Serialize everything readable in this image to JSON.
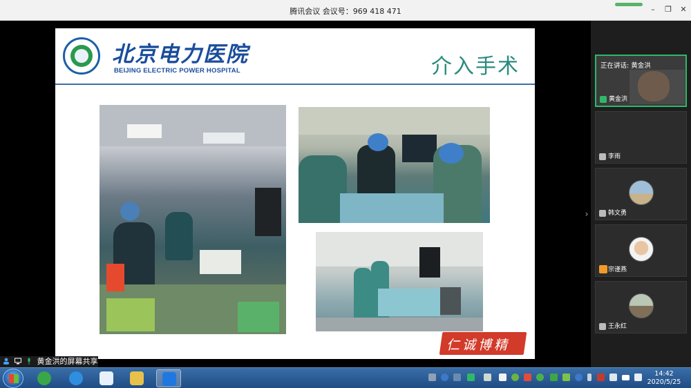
{
  "window": {
    "title": "腾讯会议 会议号：969 418 471",
    "minimize_glyph": "–",
    "restore_glyph": "❐",
    "close_glyph": "✕"
  },
  "slide": {
    "hospital_name_cn": "北京电力医院",
    "hospital_name_en": "BEIJING ELECTRIC POWER HOSPITAL",
    "heading": "介入手术",
    "stamp_text": "仁诚博精"
  },
  "share_label": "黄金洪的屏幕共享",
  "panel": {
    "collapse_glyph": "›",
    "active_speaker_prefix": "正在讲话: 黄金洪",
    "participants": [
      {
        "name": "黄金洪",
        "icon": "mic-active-icon"
      },
      {
        "name": "李雨",
        "icon": "mic-muted-icon"
      },
      {
        "name": "韩文勇",
        "icon": "mic-muted-icon"
      },
      {
        "name": "宗谨燕",
        "icon": "host-icon"
      },
      {
        "name": "王永红",
        "icon": "mic-muted-icon"
      }
    ]
  },
  "taskbar": {
    "time": "14:42",
    "date": "2020/5/25"
  },
  "colors": {
    "accent_green": "#2fb86a",
    "heading_teal": "#2b8a7e",
    "hospital_blue": "#1a4d9c",
    "stamp_red": "#d23a2a",
    "taskbar_blue": "#1f4d86"
  }
}
